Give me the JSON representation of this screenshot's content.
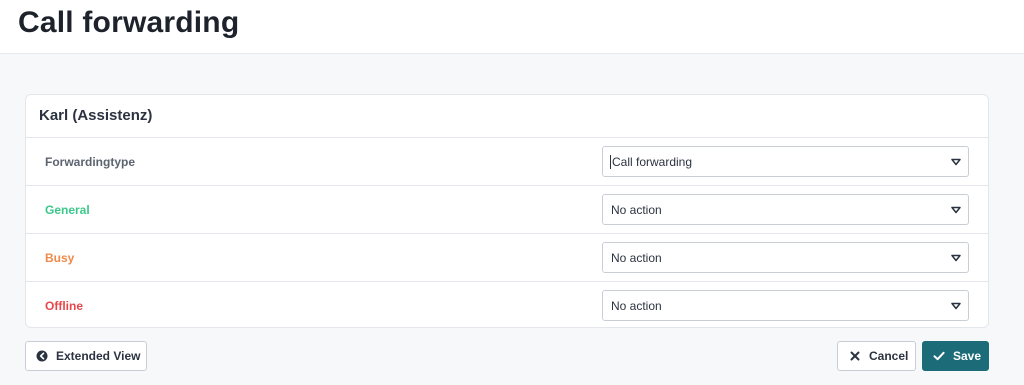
{
  "header": {
    "title": "Call forwarding"
  },
  "card": {
    "title": "Karl (Assistenz)",
    "rows": [
      {
        "label": "Forwardingtype",
        "value": "Call forwarding",
        "color": "#5c6470"
      },
      {
        "label": "General",
        "value": "No action",
        "color": "#3cc88c"
      },
      {
        "label": "Busy",
        "value": "No action",
        "color": "#ee8a4a"
      },
      {
        "label": "Offline",
        "value": "No action",
        "color": "#e8474a"
      }
    ]
  },
  "footer": {
    "extended_view_label": "Extended View",
    "extended_view_icon": "arrow-left-circle-icon",
    "cancel_label": "Cancel",
    "cancel_icon": "close-icon",
    "save_label": "Save",
    "save_icon": "checkmark-icon"
  },
  "colors": {
    "primary": "#1b6b78"
  }
}
